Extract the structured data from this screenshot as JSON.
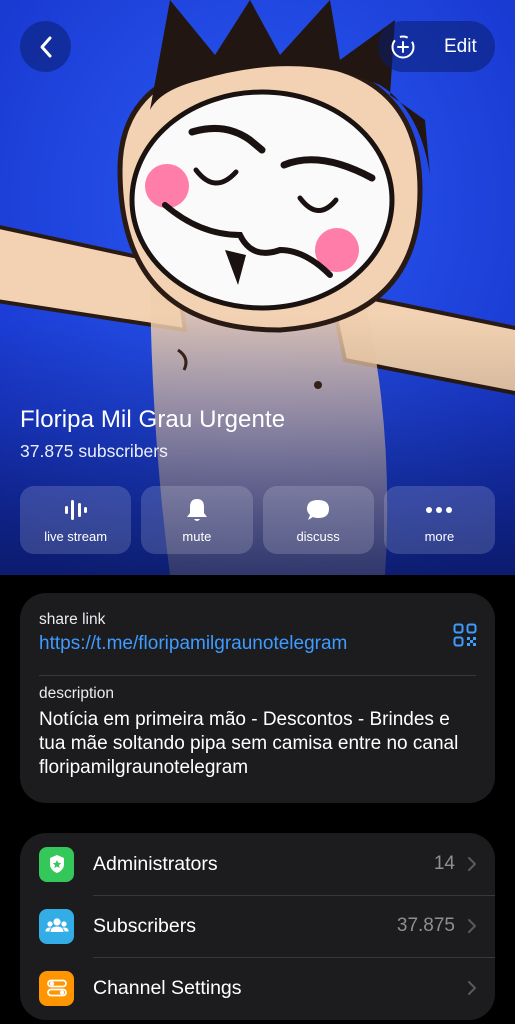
{
  "nav": {
    "back_icon": "chevron-left-icon",
    "add_icon": "add-circle-dashed-icon",
    "edit_label": "Edit"
  },
  "channel": {
    "title": "Floripa Mil Grau Urgente",
    "subscribers": "37.875 subscribers"
  },
  "actions": [
    {
      "label": "live stream",
      "icon": "waveform-icon"
    },
    {
      "label": "mute",
      "icon": "bell-icon"
    },
    {
      "label": "discuss",
      "icon": "chat-bubble-icon"
    },
    {
      "label": "more",
      "icon": "ellipsis-icon"
    }
  ],
  "info": {
    "share_link_label": "share link",
    "share_link": "https://t.me/floripamilgraunotelegram",
    "description_label": "description",
    "description": "Notícia em primeira mão - Descontos - Brindes e tua mãe soltando pipa sem camisa entre no canal floripamilgraunotelegram"
  },
  "menu": [
    {
      "label": "Administrators",
      "value": "14",
      "icon": "shield-icon",
      "color": "#34c759"
    },
    {
      "label": "Subscribers",
      "value": "37.875",
      "icon": "people-icon",
      "color": "#32ade6"
    },
    {
      "label": "Channel Settings",
      "value": "",
      "icon": "toggles-icon",
      "color": "#ff9500"
    }
  ],
  "colors": {
    "accent": "#3e9bff",
    "hero_bg": "#1c3fe4",
    "card_bg": "#1c1c1e"
  }
}
